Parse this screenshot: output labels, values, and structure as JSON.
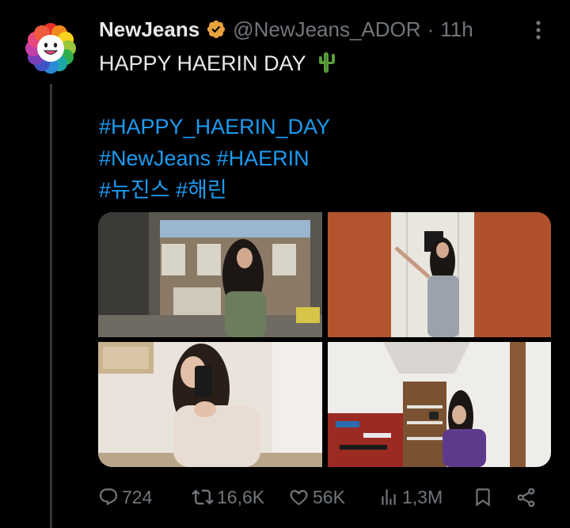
{
  "tweet": {
    "author_name": "NewJeans",
    "handle": "@NewJeans_ADOR",
    "separator": "·",
    "time": "11h",
    "text_line1": "HAPPY HAERIN DAY",
    "hashtag_line1": "#HAPPY_HAERIN_DAY",
    "hashtag_line2a": "#NewJeans",
    "hashtag_line2b": "#HAERIN",
    "hashtag_line3a": "#뉴진스",
    "hashtag_line3b": "#해린"
  },
  "actions": {
    "replies": "724",
    "reposts": "16,6K",
    "likes": "56K",
    "views": "1,3M"
  },
  "colors": {
    "background": "#000000",
    "text": "#e7e9ea",
    "muted": "#71767b",
    "link": "#1d9bf0",
    "verified": "#e8a33d"
  }
}
